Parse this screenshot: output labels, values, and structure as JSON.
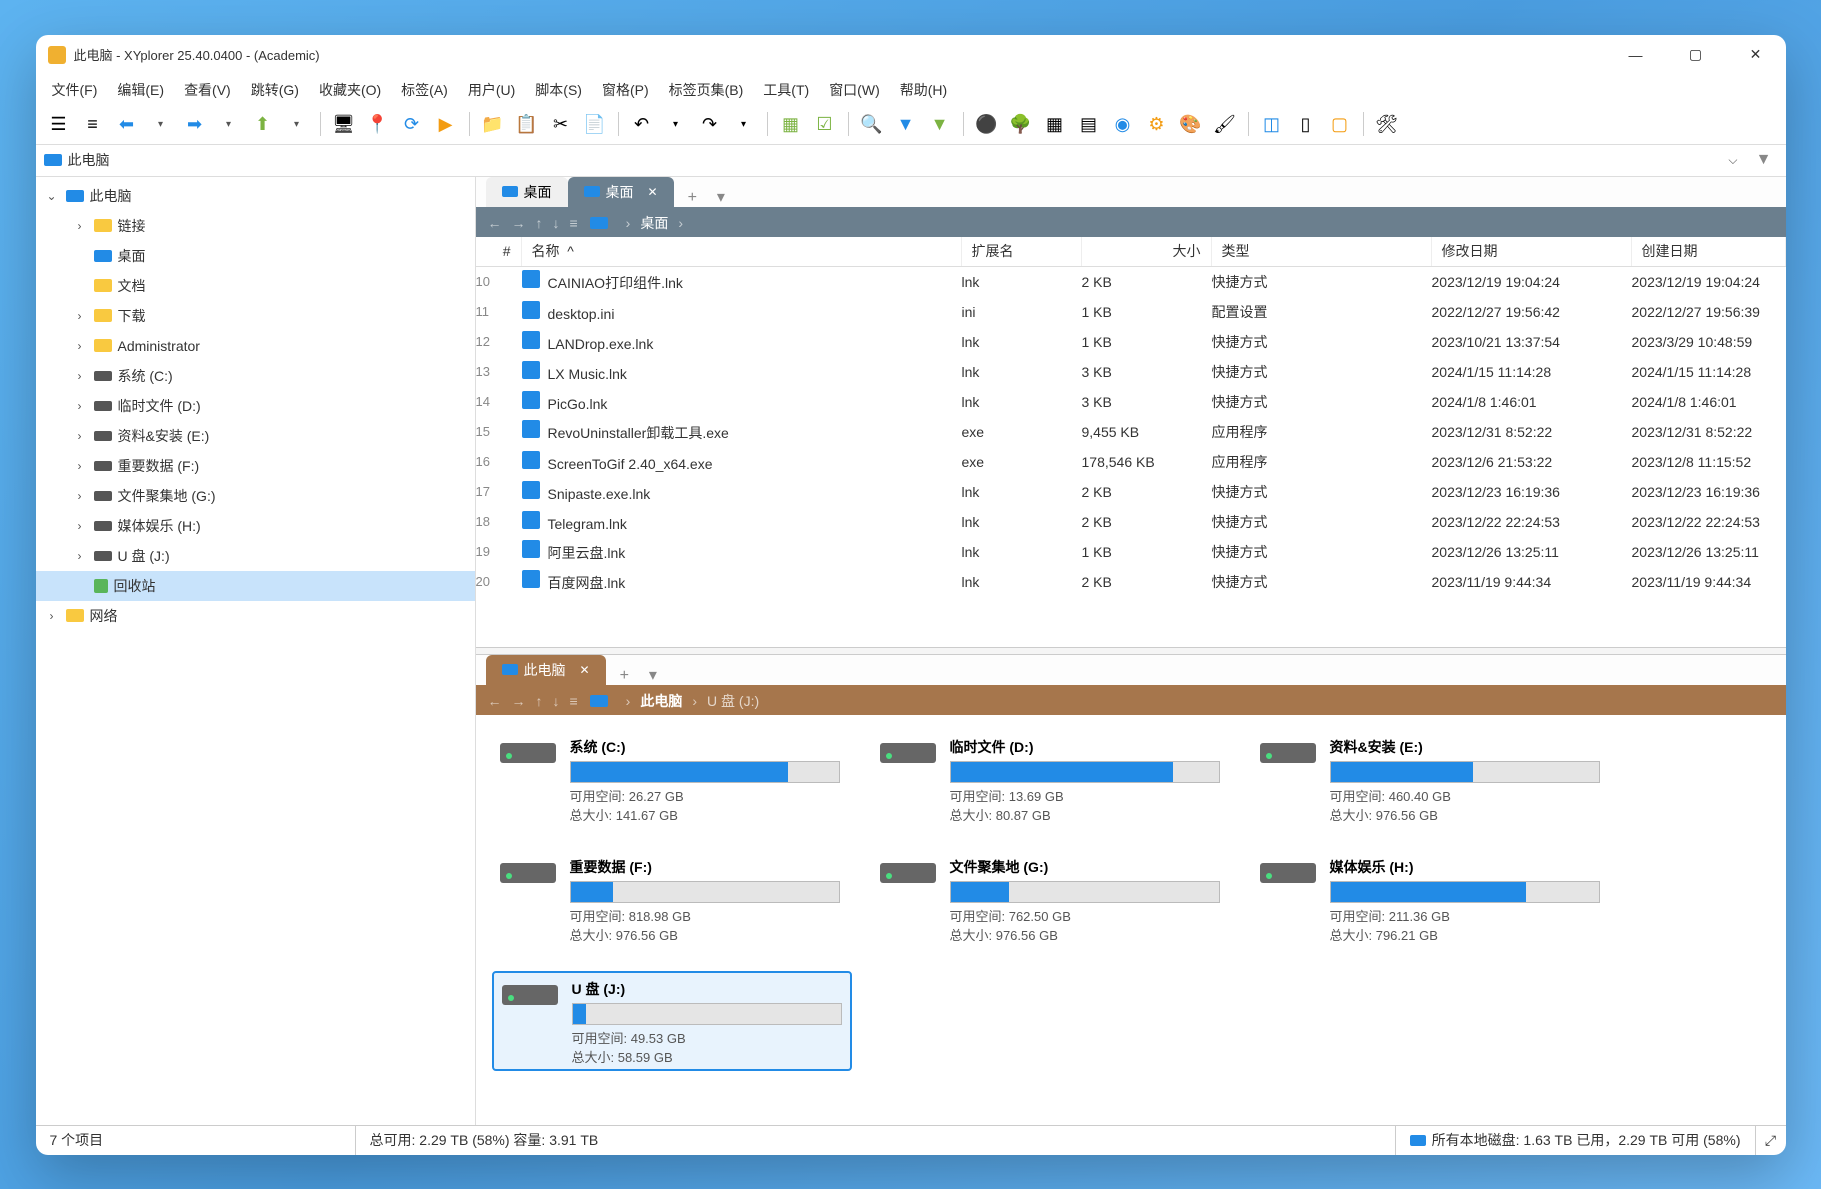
{
  "window": {
    "title": "此电脑 - XYplorer 25.40.0400 - (Academic)"
  },
  "menu": [
    "文件(F)",
    "编辑(E)",
    "查看(V)",
    "跳转(G)",
    "收藏夹(O)",
    "标签(A)",
    "用户(U)",
    "脚本(S)",
    "窗格(P)",
    "标签页集(B)",
    "工具(T)",
    "窗口(W)",
    "帮助(H)"
  ],
  "address": {
    "text": "此电脑"
  },
  "tree": [
    {
      "level": 0,
      "label": "此电脑",
      "icon": "computer",
      "expanded": true
    },
    {
      "level": 1,
      "label": "链接",
      "icon": "folder",
      "toggle": "›"
    },
    {
      "level": 1,
      "label": "桌面",
      "icon": "computer"
    },
    {
      "level": 1,
      "label": "文档",
      "icon": "folder"
    },
    {
      "level": 1,
      "label": "下载",
      "icon": "folder",
      "toggle": "›"
    },
    {
      "level": 1,
      "label": "Administrator",
      "icon": "folder",
      "toggle": "›"
    },
    {
      "level": 1,
      "label": "系统 (C:)",
      "icon": "drive",
      "toggle": "›"
    },
    {
      "level": 1,
      "label": "临时文件 (D:)",
      "icon": "drive",
      "toggle": "›"
    },
    {
      "level": 1,
      "label": "资料&安装 (E:)",
      "icon": "drive",
      "toggle": "›"
    },
    {
      "level": 1,
      "label": "重要数据 (F:)",
      "icon": "drive",
      "toggle": "›"
    },
    {
      "level": 1,
      "label": "文件聚集地 (G:)",
      "icon": "drive",
      "toggle": "›"
    },
    {
      "level": 1,
      "label": "媒体娱乐 (H:)",
      "icon": "drive",
      "toggle": "›"
    },
    {
      "level": 1,
      "label": "U 盘 (J:)",
      "icon": "drive",
      "toggle": "›"
    },
    {
      "level": 1,
      "label": "回收站",
      "icon": "recycle",
      "selected": true
    },
    {
      "level": 0,
      "label": "网络",
      "icon": "folder",
      "toggle": "›"
    }
  ],
  "pane1": {
    "tabs": [
      {
        "label": "桌面",
        "active": false
      },
      {
        "label": "桌面",
        "active": true
      }
    ],
    "crumb": [
      "桌面"
    ],
    "headers": {
      "num": "#",
      "name": "名称",
      "ext": "扩展名",
      "size": "大小",
      "type": "类型",
      "mod": "修改日期",
      "cre": "创建日期"
    },
    "rows": [
      {
        "num": "10",
        "name": "CAINIAO打印组件.lnk",
        "ext": "lnk",
        "size": "2 KB",
        "type": "快捷方式",
        "mod": "2023/12/19 19:04:24",
        "cre": "2023/12/19 19:04:24"
      },
      {
        "num": "11",
        "name": "desktop.ini",
        "ext": "ini",
        "size": "1 KB",
        "type": "配置设置",
        "mod": "2022/12/27 19:56:42",
        "cre": "2022/12/27 19:56:39"
      },
      {
        "num": "12",
        "name": "LANDrop.exe.lnk",
        "ext": "lnk",
        "size": "1 KB",
        "type": "快捷方式",
        "mod": "2023/10/21 13:37:54",
        "cre": "2023/3/29 10:48:59"
      },
      {
        "num": "13",
        "name": "LX Music.lnk",
        "ext": "lnk",
        "size": "3 KB",
        "type": "快捷方式",
        "mod": "2024/1/15 11:14:28",
        "cre": "2024/1/15 11:14:28"
      },
      {
        "num": "14",
        "name": "PicGo.lnk",
        "ext": "lnk",
        "size": "3 KB",
        "type": "快捷方式",
        "mod": "2024/1/8 1:46:01",
        "cre": "2024/1/8 1:46:01"
      },
      {
        "num": "15",
        "name": "RevoUninstaller卸载工具.exe",
        "ext": "exe",
        "size": "9,455 KB",
        "type": "应用程序",
        "mod": "2023/12/31 8:52:22",
        "cre": "2023/12/31 8:52:22"
      },
      {
        "num": "16",
        "name": "ScreenToGif 2.40_x64.exe",
        "ext": "exe",
        "size": "178,546 KB",
        "type": "应用程序",
        "mod": "2023/12/6 21:53:22",
        "cre": "2023/12/8 11:15:52"
      },
      {
        "num": "17",
        "name": "Snipaste.exe.lnk",
        "ext": "lnk",
        "size": "2 KB",
        "type": "快捷方式",
        "mod": "2023/12/23 16:19:36",
        "cre": "2023/12/23 16:19:36"
      },
      {
        "num": "18",
        "name": "Telegram.lnk",
        "ext": "lnk",
        "size": "2 KB",
        "type": "快捷方式",
        "mod": "2023/12/22 22:24:53",
        "cre": "2023/12/22 22:24:53"
      },
      {
        "num": "19",
        "name": "阿里云盘.lnk",
        "ext": "lnk",
        "size": "1 KB",
        "type": "快捷方式",
        "mod": "2023/12/26 13:25:11",
        "cre": "2023/12/26 13:25:11"
      },
      {
        "num": "20",
        "name": "百度网盘.lnk",
        "ext": "lnk",
        "size": "2 KB",
        "type": "快捷方式",
        "mod": "2023/11/19 9:44:34",
        "cre": "2023/11/19 9:44:34"
      }
    ]
  },
  "pane2": {
    "tabs": [
      {
        "label": "此电脑",
        "active": true
      }
    ],
    "crumb": [
      "此电脑",
      "U 盘 (J:)"
    ],
    "drives": [
      {
        "name": "系统 (C:)",
        "free": "可用空间: 26.27 GB",
        "total": "总大小: 141.67 GB",
        "pct": 81
      },
      {
        "name": "临时文件 (D:)",
        "free": "可用空间: 13.69 GB",
        "total": "总大小: 80.87 GB",
        "pct": 83
      },
      {
        "name": "资料&安装 (E:)",
        "free": "可用空间: 460.40 GB",
        "total": "总大小: 976.56 GB",
        "pct": 53
      },
      {
        "name": "重要数据 (F:)",
        "free": "可用空间: 818.98 GB",
        "total": "总大小: 976.56 GB",
        "pct": 16
      },
      {
        "name": "文件聚集地 (G:)",
        "free": "可用空间: 762.50 GB",
        "total": "总大小: 976.56 GB",
        "pct": 22
      },
      {
        "name": "媒体娱乐 (H:)",
        "free": "可用空间: 211.36 GB",
        "total": "总大小: 796.21 GB",
        "pct": 73
      },
      {
        "name": "U 盘 (J:)",
        "free": "可用空间: 49.53 GB",
        "total": "总大小: 58.59 GB",
        "pct": 5,
        "selected": true
      }
    ]
  },
  "statusbar": {
    "items": "7 个项目",
    "total": "总可用: 2.29 TB (58%)    容量: 3.91 TB",
    "drives": "所有本地磁盘: 1.63 TB 已用，2.29 TB 可用 (58%)"
  }
}
